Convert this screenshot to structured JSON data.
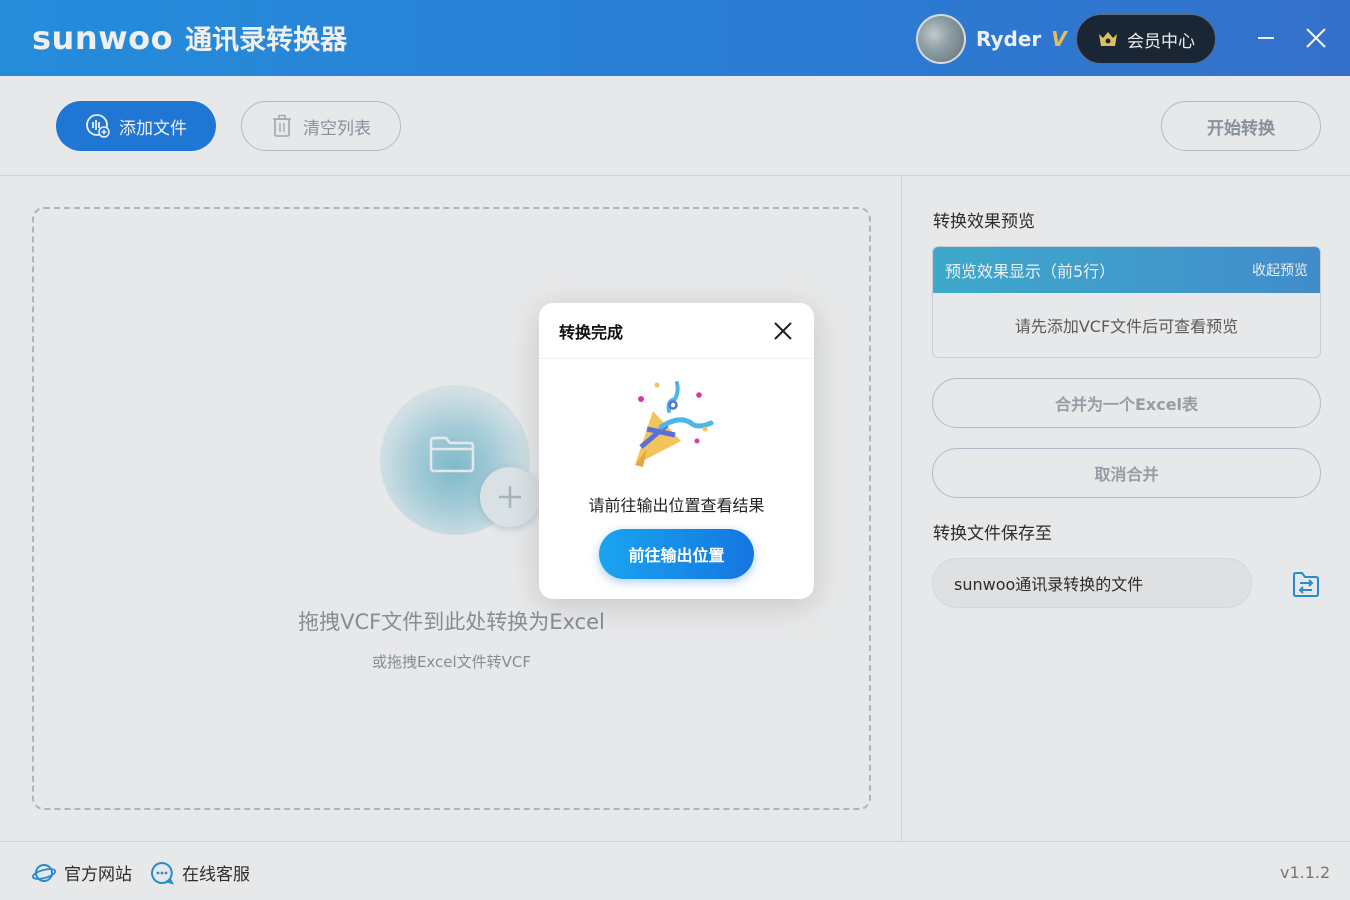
{
  "app": {
    "brand_logo": "sunwoo",
    "title": "通讯录转换器",
    "username": "Ryder",
    "vip_mark": "V",
    "member_center": "会员中心"
  },
  "toolbar": {
    "add_file": "添加文件",
    "clear_list": "清空列表",
    "start_convert": "开始转换"
  },
  "dropzone": {
    "title": "拖拽VCF文件到此处转换为Excel",
    "subtitle": "或拖拽Excel文件转VCF"
  },
  "right_panel": {
    "preview_label": "转换效果预览",
    "preview_header": "预览效果显示（前5行）",
    "preview_collapse": "收起预览",
    "preview_empty": "请先添加VCF文件后可查看预览",
    "merge_button": "合并为一个Excel表",
    "unmerge_button": "取消合并",
    "save_label": "转换文件保存至",
    "save_path": "sunwoo通讯录转换的文件"
  },
  "footer": {
    "official_site": "官方网站",
    "online_service": "在线客服",
    "version": "v1.1.2"
  },
  "modal": {
    "title": "转换完成",
    "message": "请前往输出位置查看结果",
    "button": "前往输出位置"
  },
  "colors": {
    "primary": "#1476e0",
    "titlebar_start": "#1a8fe8",
    "titlebar_end": "#2a6fd6",
    "preview_header_start": "#36b0d7",
    "preview_header_end": "#3a8fd6"
  },
  "icons": [
    "folder-plus-icon",
    "trash-icon",
    "crown-icon",
    "minimize-icon",
    "close-icon",
    "folder-icon",
    "plus-icon",
    "folder-switch-icon",
    "planet-icon",
    "chat-icon",
    "party-popper-icon"
  ]
}
